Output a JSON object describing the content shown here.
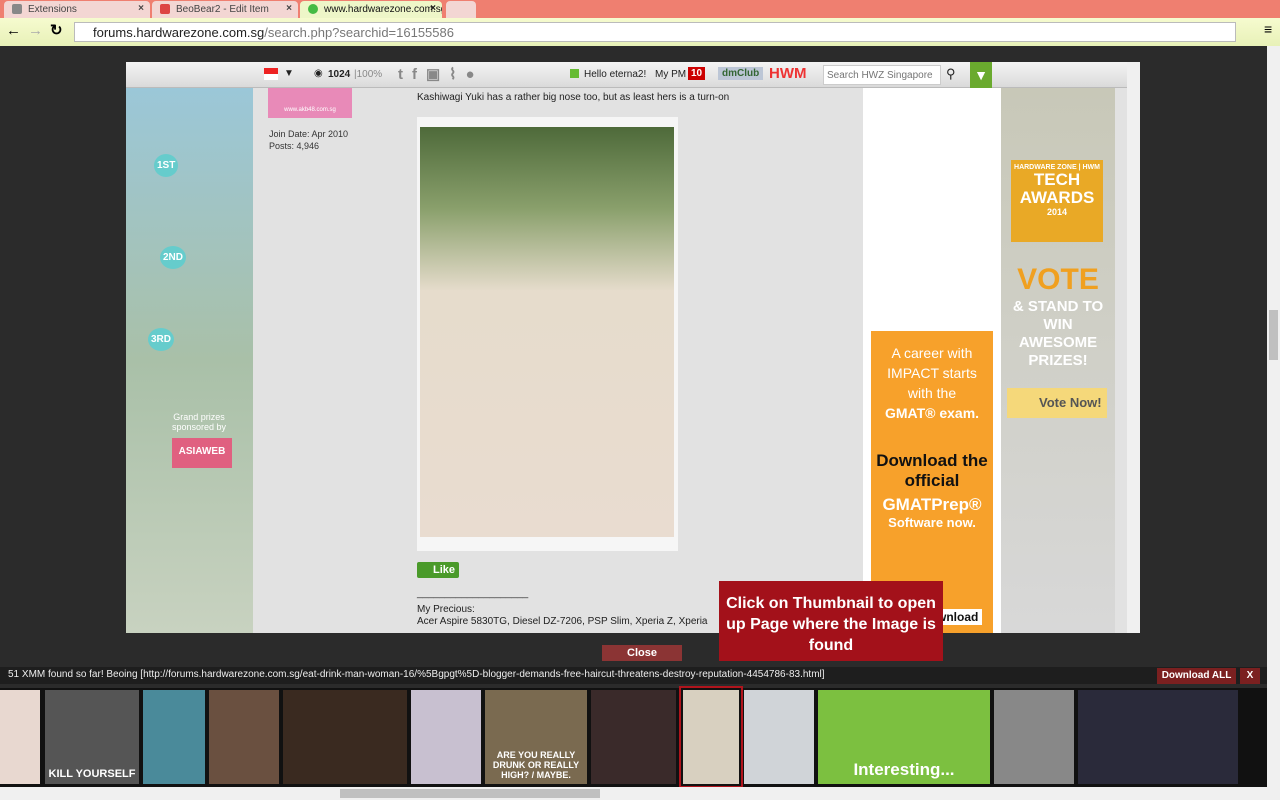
{
  "browser": {
    "tabs": [
      {
        "label": "Extensions"
      },
      {
        "label": "BeoBear2 - Edit Item"
      },
      {
        "label": "www.hardwarezone.com.sg"
      }
    ],
    "url_host": "forums.hardwarezone.com.sg",
    "url_path": "/search.php?searchid=16155586"
  },
  "site_header": {
    "views": "1024",
    "percent": "|100%",
    "greeting": "Hello eterna2!",
    "pm_label": "My PM",
    "pm_count": "10",
    "brand1": "dmClub",
    "brand2": "HWM",
    "search_placeholder": "Search HWZ Singapore"
  },
  "left_ad": {
    "place1": "1ST",
    "place2": "2ND",
    "place3": "3RD",
    "sponsor": "Grand prizes sponsored by",
    "sponsor_brand": "ASIAWEB"
  },
  "user": {
    "badge_site": "www.akb48.com.sg",
    "join_date": "Join Date: Apr 2010",
    "posts": "Posts: 4,946"
  },
  "post": {
    "text": "Kashiwagi Yuki has a rather big nose too, but as least hers is a turn-on",
    "like": "Like",
    "sig_rule": "____________________",
    "sig_title": "My Precious:",
    "sig_text": "Acer Aspire 5830TG, Diesel DZ-7206, PSP Slim, Xperia Z, Xperia"
  },
  "gmat_ad": {
    "line1": "A career with IMPACT starts with the",
    "brand": "GMAT® exam.",
    "line2": "Download the official",
    "product": "GMATPrep®",
    "line3": "Software now.",
    "cta": "Download"
  },
  "right_ad": {
    "brand": "HARDWARE ZONE | HWM",
    "title": "TECH AWARDS",
    "year": "2014",
    "vote": "VOTE",
    "sub": "& STAND TO WIN AWESOME PRIZES!",
    "button": "Vote Now!"
  },
  "tooltip": "Click on Thumbnail to open up Page where the Image is found",
  "close": "Close",
  "status": "51 XMM found so far! Beoing [http://forums.hardwarezone.com.sg/eat-drink-man-woman-16/%5Bgpgt%5D-blogger-demands-free-haircut-threatens-destroy-reputation-4454786-83.html]",
  "download_all": "Download ALL",
  "dismiss": "X",
  "thumbnails": [
    {
      "caption": ""
    },
    {
      "caption": "KILL YOURSELF"
    },
    {
      "caption": ""
    },
    {
      "caption": ""
    },
    {
      "caption": ""
    },
    {
      "caption": ""
    },
    {
      "caption": "ARE YOU REALLY DRUNK OR REALLY HIGH? / MAYBE."
    },
    {
      "caption": ""
    },
    {
      "caption": ""
    },
    {
      "caption": ""
    },
    {
      "caption": "Interesting..."
    },
    {
      "caption": ""
    },
    {
      "caption": ""
    }
  ],
  "colors": {
    "tooltip": "#a3111a",
    "tabbar": "#ef7f70",
    "gmat": "#f7a12b",
    "selected": "#b0141c"
  }
}
